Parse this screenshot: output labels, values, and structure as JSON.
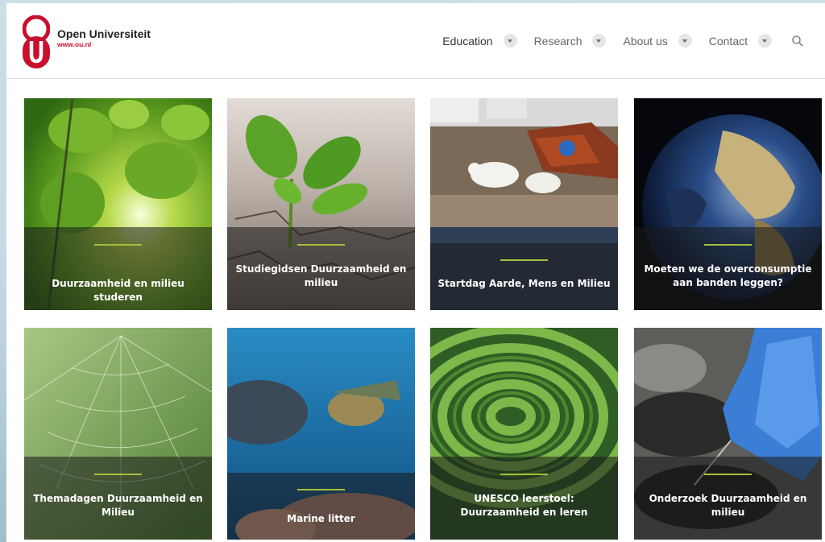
{
  "brand": {
    "name": "Open Universiteit",
    "url": "www.ou.nl",
    "color": "#c8102e"
  },
  "nav": {
    "items": [
      {
        "label": "Education"
      },
      {
        "label": "Research"
      },
      {
        "label": "About us"
      },
      {
        "label": "Contact"
      }
    ],
    "search_icon": "search-icon"
  },
  "tiles": [
    {
      "title": "Duurzaamheid en milieu studeren",
      "image": "green leaves with sunlight"
    },
    {
      "title": "Studiegidsen Duurzaamheid en milieu",
      "image": "seedling in cracked soil"
    },
    {
      "title": "Startdag Aarde, Mens en Milieu",
      "image": "polar bears near rusty debris"
    },
    {
      "title": "Moeten we de overconsumptie aan banden leggen?",
      "image": "earth from space at night"
    },
    {
      "title": "Themadagen Duurzaamheid en Milieu",
      "image": "spider web on green background"
    },
    {
      "title": "Marine litter",
      "image": "sea turtle over coral"
    },
    {
      "title": "UNESCO leerstoel: Duurzaamheid en leren",
      "image": "hedge maze spiral"
    },
    {
      "title": "Onderzoek Duurzaamheid en milieu",
      "image": "gloved hand sampling oil"
    }
  ],
  "colors": {
    "accent_bar": "#a9bd3b",
    "overlay": "#191919"
  }
}
